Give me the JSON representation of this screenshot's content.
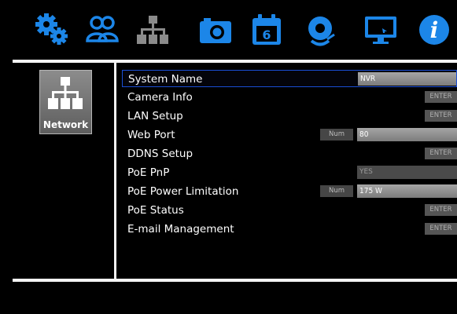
{
  "toolbar": {
    "icons": [
      "settings-gears-icon",
      "users-icon",
      "network-tree-icon",
      "camera-icon",
      "calendar-icon",
      "alarm-bell-icon",
      "monitor-icon",
      "info-icon"
    ],
    "calendar_day": "6",
    "info_glyph": "i"
  },
  "category": {
    "label": "Network",
    "icon": "network-icon"
  },
  "settings": {
    "system_name": {
      "label": "System Name",
      "value": "NVR"
    },
    "camera_info": {
      "label": "Camera Info",
      "button": "ENTER"
    },
    "lan_setup": {
      "label": "LAN Setup",
      "button": "ENTER"
    },
    "web_port": {
      "label": "Web Port",
      "num_button": "Num",
      "value": "80"
    },
    "ddns_setup": {
      "label": "DDNS Setup",
      "button": "ENTER"
    },
    "poe_pnp": {
      "label": "PoE PnP",
      "value": "YES"
    },
    "poe_power_limitation": {
      "label": "PoE Power Limitation",
      "num_button": "Num",
      "value": "175 W"
    },
    "poe_status": {
      "label": "PoE Status",
      "button": "ENTER"
    },
    "email_management": {
      "label": "E-mail Management",
      "button": "ENTER"
    }
  },
  "colors": {
    "selection_border": "#1a4fd6",
    "icon_blue": "#1c86e8",
    "frame": "#f4f4f4"
  }
}
